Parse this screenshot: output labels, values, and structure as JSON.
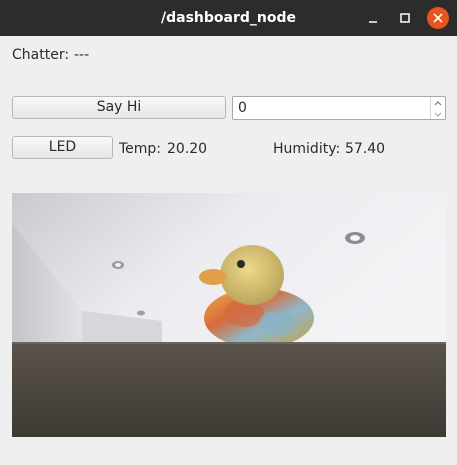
{
  "window": {
    "title": "/dashboard_node"
  },
  "chatter": {
    "label": "Chatter:",
    "value": "---"
  },
  "say_hi": {
    "button_label": "Say Hi",
    "spin_value": "0"
  },
  "led": {
    "button_label": "LED"
  },
  "sensors": {
    "temp_label": "Temp:",
    "temp_value": "20.20",
    "humidity_label": "Humidity:",
    "humidity_value": "57.40"
  },
  "icons": {
    "minimize": "minimize-icon",
    "maximize": "maximize-icon",
    "close": "close-icon",
    "spin_up": "chevron-up-icon",
    "spin_down": "chevron-down-icon"
  },
  "colors": {
    "titlebar": "#2c2c2c",
    "close_button": "#e9541f",
    "background": "#efefef"
  }
}
